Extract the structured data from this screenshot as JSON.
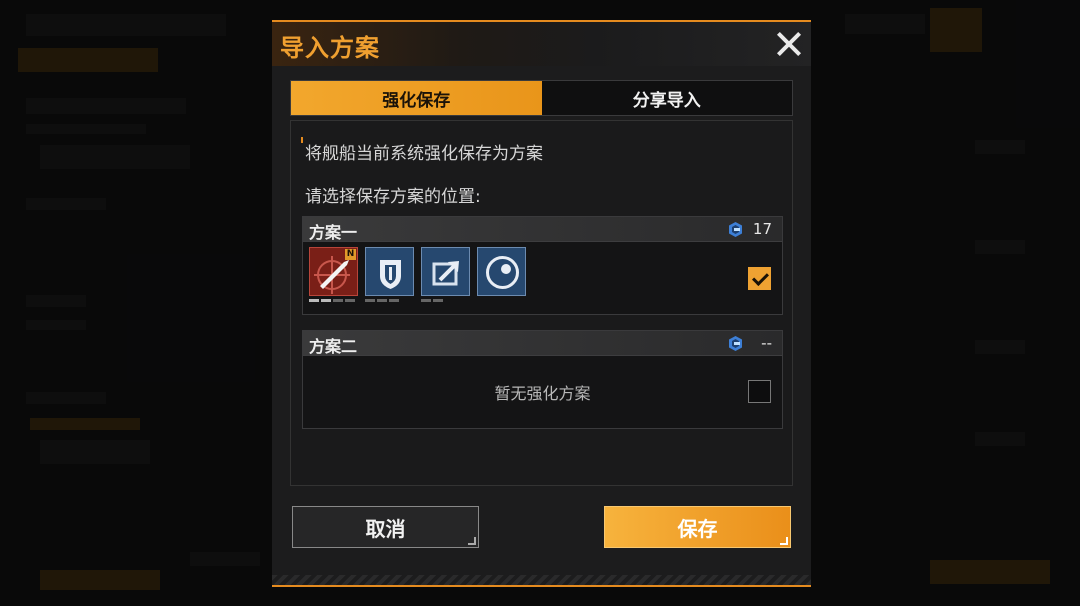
{
  "modal": {
    "title": "导入方案",
    "tabs": [
      {
        "label": "强化保存",
        "active": true
      },
      {
        "label": "分享导入",
        "active": false
      }
    ],
    "description": "将舰船当前系统强化保存为方案",
    "prompt": "请选择保存方案的位置:",
    "plans": [
      {
        "name": "方案一",
        "count": "17",
        "checked": true,
        "slots": [
          {
            "icon": "missile-icon",
            "badge": "N"
          },
          {
            "icon": "shield-icon"
          },
          {
            "icon": "arrow-upgrade-icon"
          },
          {
            "icon": "target-scope-icon"
          }
        ]
      },
      {
        "name": "方案二",
        "count": "--",
        "checked": false,
        "empty_text": "暂无强化方案"
      }
    ],
    "cancel_label": "取消",
    "save_label": "保存"
  },
  "colors": {
    "accent": "#e58b1f",
    "tab_active": "#f2a72d",
    "slot_blue": "#26486f",
    "slot_red": "#7a1f17"
  }
}
